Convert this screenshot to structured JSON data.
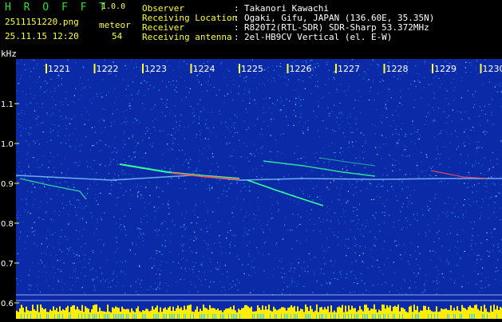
{
  "app": {
    "name": "H R O F F T",
    "version": "1.0.0",
    "filename": "2511151220.png",
    "datetime": "25.11.15 12:20",
    "meteor_label": "meteor",
    "meteor_count": "54"
  },
  "info": {
    "observer_label": "Observer",
    "observer_value": "Takanori Kawachi",
    "location_label": "Receiving Location",
    "location_value": "Ogaki, Gifu, JAPAN (136.60E, 35.35N)",
    "receiver_label": "Receiver",
    "receiver_value": "R820T2(RTL-SDR) SDR-Sharp 53.372MHz",
    "antenna_label": "Receiving antenna",
    "antenna_value": "2el-HB9CV Vertical (el. E-W)",
    "separator": ":"
  },
  "plot": {
    "y_unit": "kHz",
    "x_ticks": [
      "1221",
      "1222",
      "1223",
      "1224",
      "1225",
      "1226",
      "1227",
      "1228",
      "1229",
      "1230"
    ],
    "y_ticks": [
      "1.1",
      "1.0",
      "0.9",
      "0.8",
      "0.7",
      "0.6"
    ],
    "colors": {
      "background": "#0a2aa8",
      "noise": "#3a9cff",
      "signal_mid": "#33ff99",
      "signal_hot": "#ff3333",
      "level_bar": "#ffee00",
      "tick": "#ffff33",
      "label": "#ffffff"
    }
  }
}
